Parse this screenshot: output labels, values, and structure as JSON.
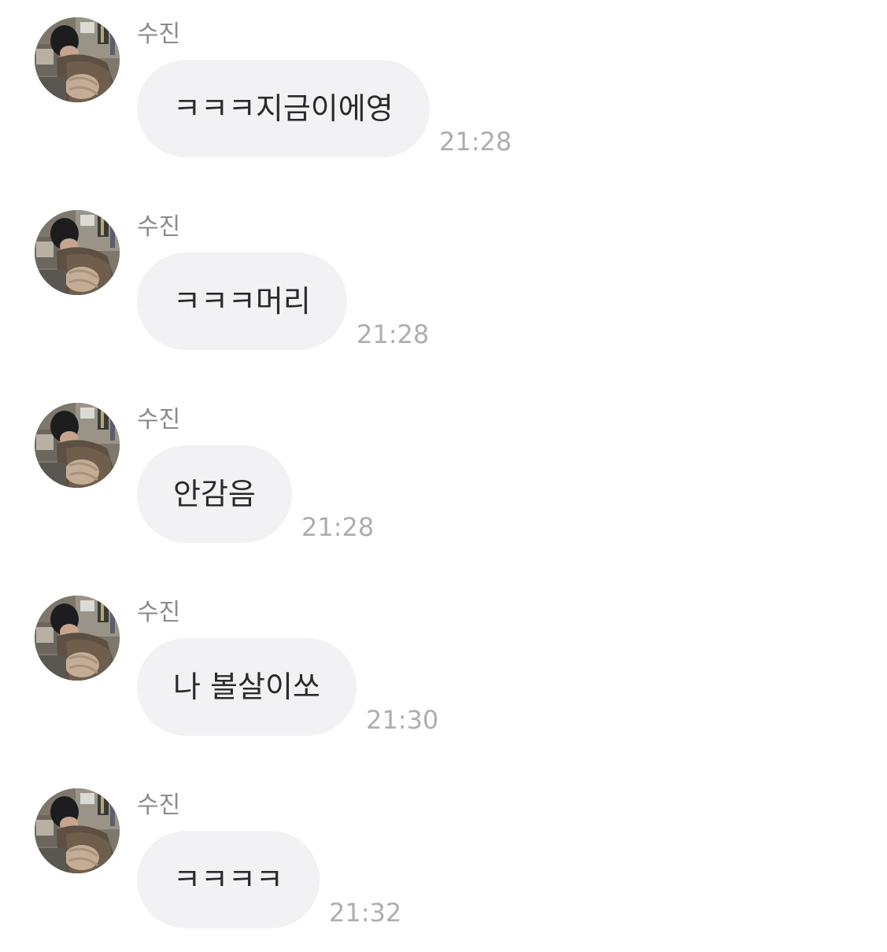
{
  "messages": [
    {
      "sender": "수진",
      "text": "ㅋㅋㅋ지금이에영",
      "time": "21:28"
    },
    {
      "sender": "수진",
      "text": "ㅋㅋㅋ머리",
      "time": "21:28"
    },
    {
      "sender": "수진",
      "text": "안감음",
      "time": "21:28"
    },
    {
      "sender": "수진",
      "text": "나 볼살이쏘",
      "time": "21:30"
    },
    {
      "sender": "수진",
      "text": "ㅋㅋㅋㅋ",
      "time": "21:32"
    }
  ],
  "colors": {
    "bubble": "#f2f2f5",
    "sender_text": "#8a8a8e",
    "time_text": "#aeaeb2",
    "message_text": "#2a2a2c"
  },
  "icons": {
    "avatar": "profile-photo"
  }
}
